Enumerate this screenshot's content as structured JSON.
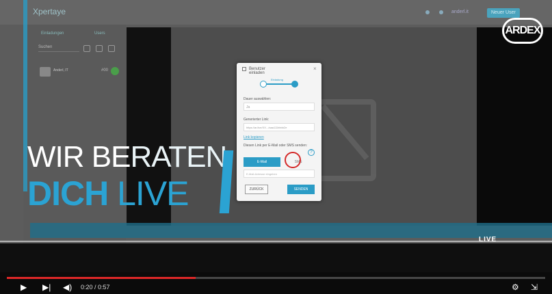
{
  "brand": {
    "app_logo": "Xpertaye",
    "corner_logo": "ARDEX"
  },
  "app": {
    "top_button": "Neuer User",
    "sidebar_tabs": [
      "Einladungen",
      "Users"
    ],
    "sidebar_search": "Suchen",
    "user_name": "Anderl, IT",
    "user_badge": "#00"
  },
  "modal": {
    "title": "Benutzer einladen",
    "step_label": "Einladung",
    "select_label": "Dauer auswählen:",
    "select_value": "Ja",
    "link_label": "Generierter Link:",
    "link_value": "https://ar.live/XX.../aaa111bbbb2e",
    "link_copy": "Link kopieren",
    "send_label": "Diesen Link per E-Mail oder SMS senden:",
    "tab_email": "E-Mail",
    "tab_sms": "SMS",
    "email_placeholder": "E-Mail-Adresse eingeben",
    "back_button": "ZURÜCK",
    "send_button": "SENDEN"
  },
  "overlay": {
    "line1_a": "WIR BE",
    "line1_b": "RATEN",
    "line2_a": "DICH",
    "line2_b": "LIVE"
  },
  "strip": {
    "text": "LIVE"
  },
  "player": {
    "time_current": "0:20",
    "time_total": "0:57",
    "time_display": "0:20 / 0:57",
    "progress": 0.351,
    "play_icon": "play-icon",
    "next_icon": "next-icon",
    "volume_icon": "volume-icon",
    "settings_icon": "gear-icon",
    "exit_fullscreen_icon": "exit-fullscreen-icon"
  },
  "colors": {
    "accent": "#2ba3d3",
    "progress": "#e02828"
  }
}
